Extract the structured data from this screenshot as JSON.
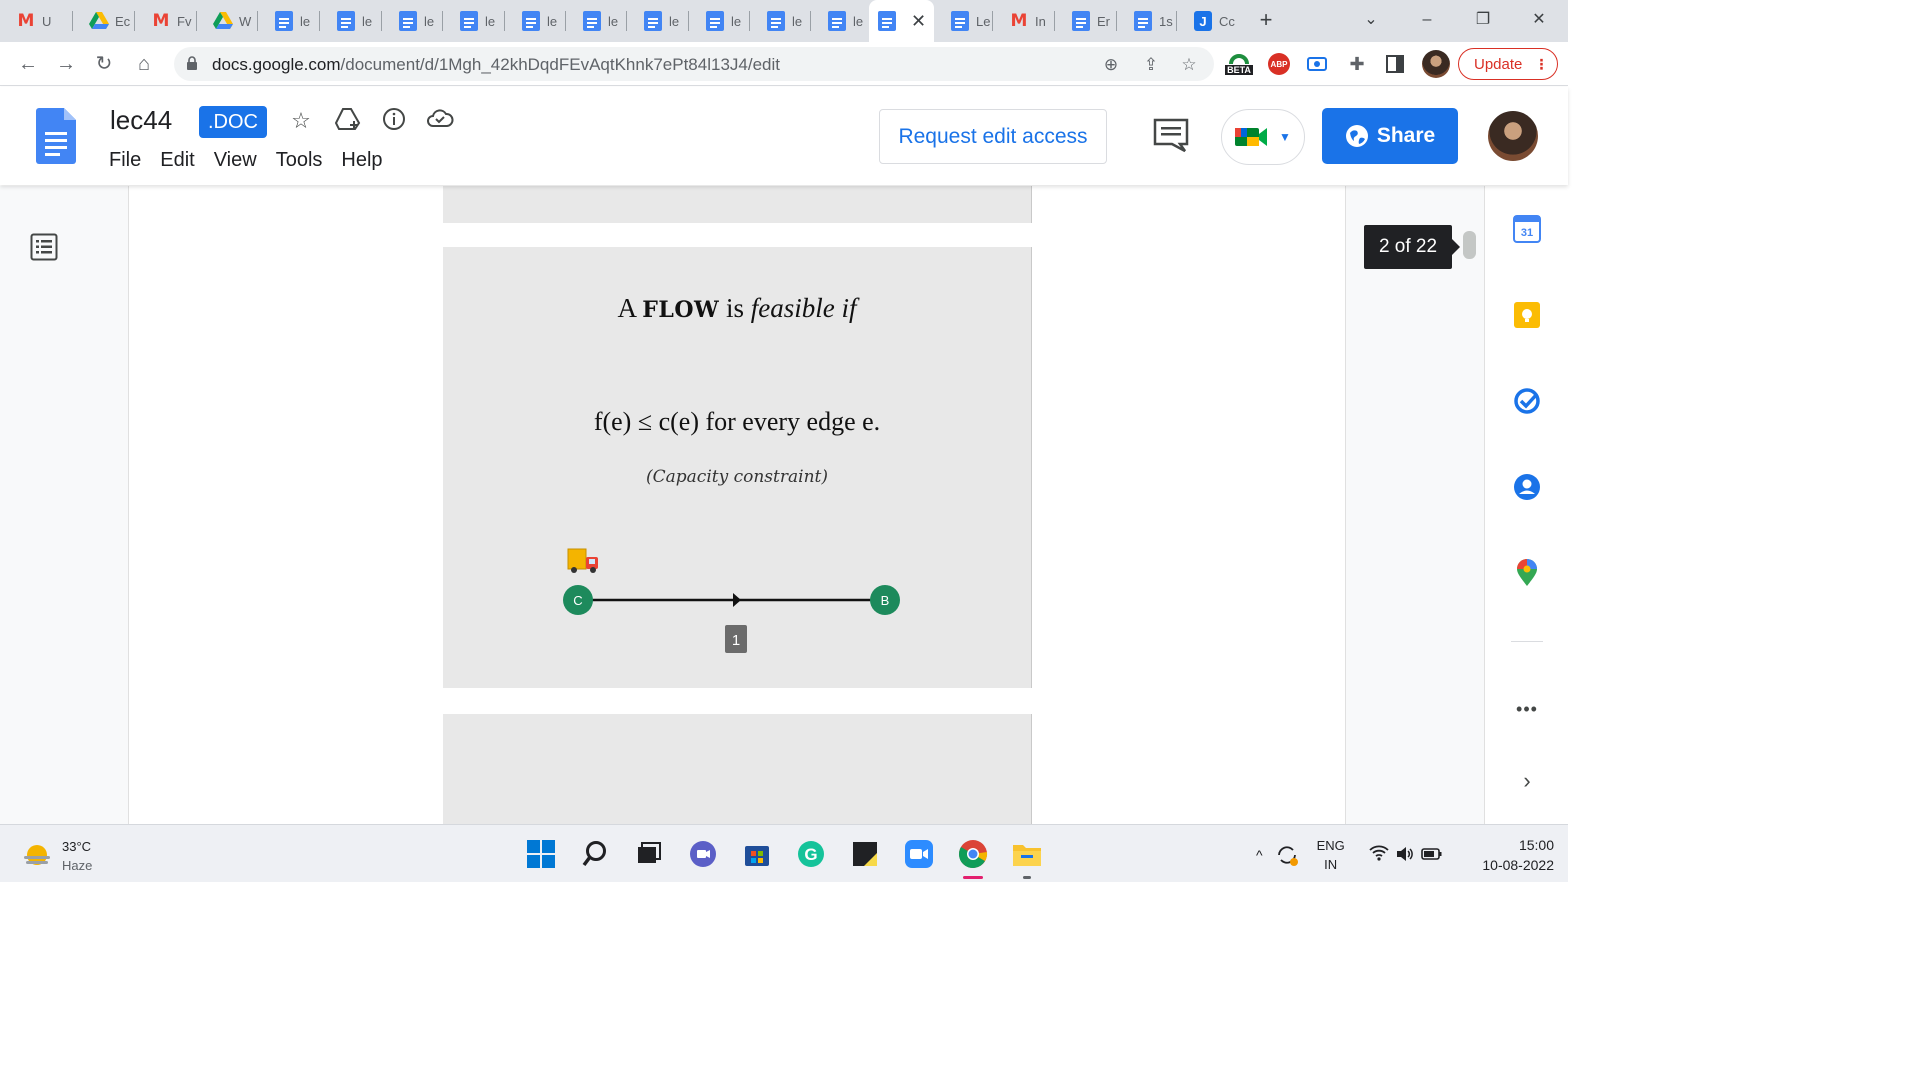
{
  "browser": {
    "tabs": [
      {
        "icon": "gmail-icon",
        "label": "U"
      },
      {
        "icon": "google-drive-icon",
        "label": "Ec"
      },
      {
        "icon": "gmail-icon",
        "label": "Fv"
      },
      {
        "icon": "google-drive-icon",
        "label": "W"
      },
      {
        "icon": "google-docs-icon",
        "label": "le"
      },
      {
        "icon": "google-docs-icon",
        "label": "le"
      },
      {
        "icon": "google-docs-icon",
        "label": "le"
      },
      {
        "icon": "google-docs-icon",
        "label": "le"
      },
      {
        "icon": "google-docs-icon",
        "label": "le"
      },
      {
        "icon": "google-docs-icon",
        "label": "le"
      },
      {
        "icon": "google-docs-icon",
        "label": "le"
      },
      {
        "icon": "google-docs-icon",
        "label": "le"
      },
      {
        "icon": "google-docs-icon",
        "label": "le"
      },
      {
        "icon": "google-docs-icon",
        "label": "le"
      },
      {
        "icon": "google-docs-icon",
        "label": "",
        "active": true
      },
      {
        "icon": "google-docs-icon",
        "label": "Le"
      },
      {
        "icon": "gmail-icon",
        "label": "In"
      },
      {
        "icon": "google-docs-icon",
        "label": "Er"
      },
      {
        "icon": "google-docs-icon",
        "label": "1s"
      },
      {
        "icon": "j-app-icon",
        "label": "Cc"
      }
    ],
    "url_host": "docs.google.com",
    "url_path": "/document/d/1Mgh_42khDqdFEvAqtKhnk7ePt84l13J4/edit",
    "beta_label": "BETA",
    "abp_label": "ABP",
    "update_label": "Update"
  },
  "docs": {
    "title": "lec44",
    "badge": ".DOC",
    "menu": [
      "File",
      "Edit",
      "View",
      "Tools",
      "Help"
    ],
    "request_access": "Request edit access",
    "share": "Share"
  },
  "slide": {
    "title_prefix": "A",
    "title_bold": "FLOW",
    "title_mid": "is",
    "title_italic": "feasible if",
    "formula": "f(e) ≤ c(e) for every edge e.",
    "note": "(Capacity constraint)",
    "node_left": "C",
    "node_right": "B",
    "edge_capacity": "1"
  },
  "page_indicator": "2 of 22",
  "side_panel": {
    "calendar_day": "31"
  },
  "taskbar": {
    "temperature": "33°C",
    "condition": "Haze",
    "language_top": "ENG",
    "language_bottom": "IN",
    "time": "15:00",
    "date": "10-08-2022"
  },
  "colors": {
    "accent": "#1a73e8",
    "node_fill": "#1d8a5c",
    "slide_bg": "#e8e8e8"
  }
}
